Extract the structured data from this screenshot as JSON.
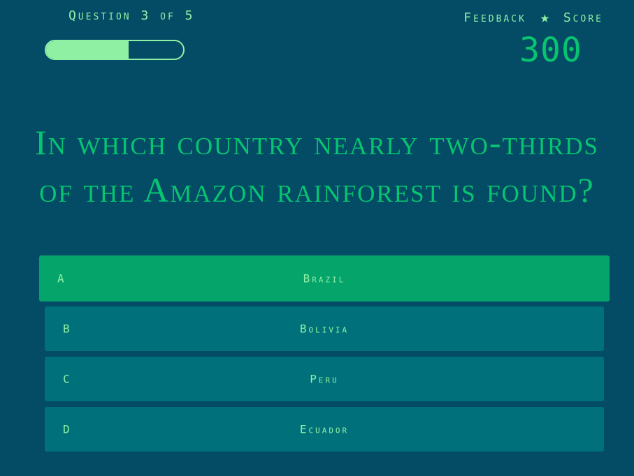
{
  "header": {
    "question_counter": "Question 3 of 5",
    "progress_fraction": 0.6,
    "feedback_label": "Feedback",
    "star_glyph": "★",
    "score_label": "Score",
    "score_value": "300"
  },
  "question": {
    "text": "In which country nearly two-thirds of the Amazon rainforest is found?"
  },
  "answers": [
    {
      "letter": "A",
      "text": "Brazil",
      "selected": true
    },
    {
      "letter": "B",
      "text": "Bolivia",
      "selected": false
    },
    {
      "letter": "C",
      "text": "Peru",
      "selected": false
    },
    {
      "letter": "D",
      "text": "Ecuador",
      "selected": false
    }
  ],
  "colors": {
    "background": "#044b66",
    "accent_light": "#8ff0a4",
    "accent_green": "#06c470",
    "answer_bg": "#00717a",
    "answer_selected_bg": "#04a46b"
  },
  "icons": {
    "star": "star-icon"
  }
}
